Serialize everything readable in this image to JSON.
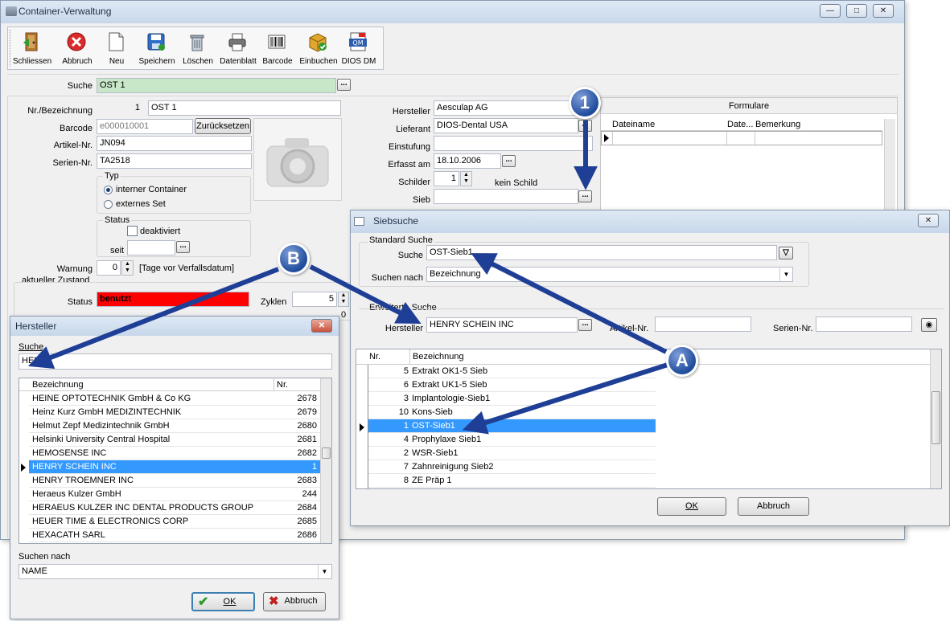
{
  "main_window": {
    "title": "Container-Verwaltung",
    "toolbar": [
      {
        "label": "Schliessen",
        "icon": "exit-door-icon"
      },
      {
        "label": "Abbruch",
        "icon": "cancel-icon"
      },
      {
        "label": "Neu",
        "icon": "new-document-icon"
      },
      {
        "label": "Speichern",
        "icon": "save-icon"
      },
      {
        "label": "Löschen",
        "icon": "trash-icon"
      },
      {
        "label": "Datenblatt",
        "icon": "printer-icon"
      },
      {
        "label": "Barcode",
        "icon": "barcode-icon"
      },
      {
        "label": "Einbuchen",
        "icon": "box-check-icon"
      },
      {
        "label": "DIOS DM",
        "icon": "qm-pdf-icon"
      }
    ],
    "suche_label": "Suche",
    "suche_value": "OST 1",
    "nr_label": "Nr./Bezeichnung",
    "nr_value": "1",
    "bezeichnung_value": "OST 1",
    "barcode_label": "Barcode",
    "barcode_value": "e000010001",
    "zuruecksetzen_label": "Zurücksetzen",
    "artikel_label": "Artikel-Nr.",
    "artikel_value": "JN094",
    "serien_label": "Serien-Nr.",
    "serien_value": "TA2518",
    "typ_label": "Typ",
    "typ_interner": "interner Container",
    "typ_externes": "externes Set",
    "status_group_label": "Status",
    "deaktiviert_label": "deaktiviert",
    "seit_label": "seit",
    "warnung_label": "Warnung",
    "warnung_value": "0",
    "warnung_hint": "[Tage vor Verfallsdatum]",
    "zustand_label": "aktueller Zustand",
    "status_label": "Status",
    "status_value": "benutzt",
    "zyklen_label": "Zyklen",
    "zyklen_value": "5",
    "extra_value": "0",
    "hersteller_label": "Hersteller",
    "hersteller_value": "Aesculap AG",
    "lieferant_label": "Lieferant",
    "lieferant_value": "DIOS-Dental USA",
    "einstufung_label": "Einstufung",
    "erfasst_label": "Erfasst am",
    "erfasst_value": "18.10.2006",
    "schilder_label": "Schilder",
    "schilder_value": "1",
    "schild_hint": "kein Schild",
    "sieb_label": "Sieb",
    "formulare_title": "Formulare",
    "formulare_cols": [
      "Dateiname",
      "Date...",
      "Bemerkung"
    ]
  },
  "siebsuche": {
    "title": "Siebsuche",
    "standard_label": "Standard Suche",
    "suche_label": "Suche",
    "suche_value": "OST-Sieb1",
    "suchen_nach_label": "Suchen nach",
    "suchen_nach_value": "Bezeichnung",
    "erweitert_label": "Erweiterte Suche",
    "hersteller_label": "Hersteller",
    "hersteller_value": "HENRY SCHEIN INC",
    "artikel_label": "Artikel-Nr.",
    "serien_label": "Serien-Nr.",
    "col_nr": "Nr.",
    "col_bez": "Bezeichnung",
    "rows": [
      {
        "nr": "5",
        "bez": "Extrakt OK1-5 Sieb",
        "selected": false
      },
      {
        "nr": "6",
        "bez": "Extrakt UK1-5 Sieb",
        "selected": false
      },
      {
        "nr": "3",
        "bez": "Implantologie-Sieb1",
        "selected": false
      },
      {
        "nr": "10",
        "bez": "Kons-Sieb",
        "selected": false
      },
      {
        "nr": "1",
        "bez": "OST-Sieb1",
        "selected": true
      },
      {
        "nr": "4",
        "bez": "Prophylaxe Sieb1",
        "selected": false
      },
      {
        "nr": "2",
        "bez": "WSR-Sieb1",
        "selected": false
      },
      {
        "nr": "7",
        "bez": "Zahnreinigung Sieb2",
        "selected": false
      },
      {
        "nr": "8",
        "bez": "ZE Präp 1",
        "selected": false
      }
    ],
    "ok_label": "OK",
    "abbruch_label": "Abbruch"
  },
  "hersteller_dialog": {
    "title": "Hersteller",
    "suche_label": "Suche",
    "suche_value": "HEN",
    "col_bez": "Bezeichnung",
    "col_nr": "Nr.",
    "rows": [
      {
        "bez": "HEINE OPTOTECHNIK GmbH & Co KG",
        "nr": "2678",
        "selected": false
      },
      {
        "bez": "Heinz Kurz GmbH MEDIZINTECHNIK",
        "nr": "2679",
        "selected": false
      },
      {
        "bez": "Helmut Zepf Medizintechnik GmbH",
        "nr": "2680",
        "selected": false
      },
      {
        "bez": "Helsinki University Central Hospital",
        "nr": "2681",
        "selected": false
      },
      {
        "bez": "HEMOSENSE INC",
        "nr": "2682",
        "selected": false
      },
      {
        "bez": "HENRY SCHEIN INC",
        "nr": "1",
        "selected": true
      },
      {
        "bez": "HENRY TROEMNER INC",
        "nr": "2683",
        "selected": false
      },
      {
        "bez": "Heraeus Kulzer GmbH",
        "nr": "244",
        "selected": false
      },
      {
        "bez": "HERAEUS KULZER INC DENTAL PRODUCTS GROUP",
        "nr": "2684",
        "selected": false
      },
      {
        "bez": "HEUER TIME & ELECTRONICS CORP",
        "nr": "2685",
        "selected": false
      },
      {
        "bez": "HEXACATH SARL",
        "nr": "2686",
        "selected": false
      }
    ],
    "suchen_nach_label": "Suchen nach",
    "suchen_nach_value": "NAME",
    "ok_label": "OK",
    "abbruch_label": "Abbruch"
  },
  "callouts": {
    "one": "1",
    "a": "A",
    "b": "B"
  },
  "colors": {
    "status_red": "#ff0000",
    "selection": "#3399ff",
    "callout": "#1f4c9c",
    "arrow": "#1f3f96"
  }
}
